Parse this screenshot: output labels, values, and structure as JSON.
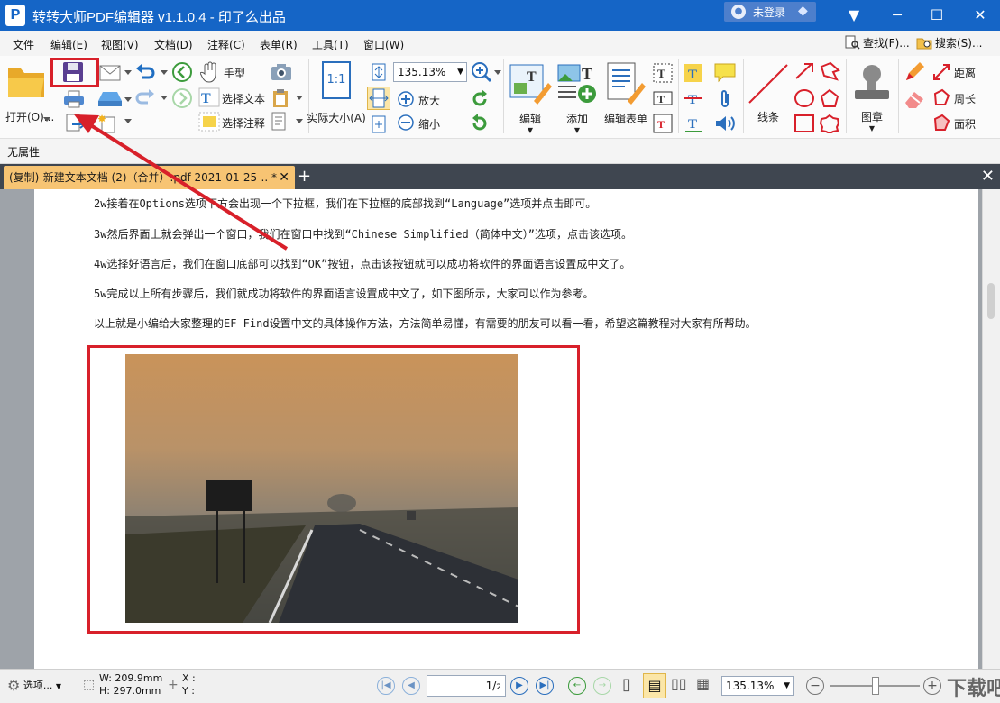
{
  "titlebar": {
    "title": "转转大师PDF编辑器 v1.1.0.4 - 印了么出品",
    "user_status": "未登录",
    "logo_letter": "P",
    "accent": "#1565c6"
  },
  "menubar": {
    "items": [
      "文件",
      "编辑(E)",
      "视图(V)",
      "文档(D)",
      "注释(C)",
      "表单(R)",
      "工具(T)",
      "窗口(W)"
    ],
    "find_label": "查找(F)...",
    "search_label": "搜索(S)..."
  },
  "toolbar": {
    "open_label": "打开(O)...",
    "hand_label": "手型",
    "select_text_label": "选择文本",
    "select_annot_label": "选择注释",
    "actual_size_label": "实际大小(A)",
    "actual_size_icon_text": "1:1",
    "zoom_value": "135.13%",
    "zoom_in_label": "放大",
    "zoom_out_label": "缩小",
    "edit_label": "编辑",
    "add_label": "添加",
    "edit_form_label": "编辑表单",
    "lines_label": "线条",
    "stamp_label": "图章",
    "distance_label": "距离",
    "perimeter_label": "周长",
    "area_label": "面积"
  },
  "propbar": {
    "label": "无属性"
  },
  "tabs": {
    "active_label": "(复制)-新建文本文档 (2)（合并）.pdf-2021-01-25-.. *",
    "active_color": "#f7c473"
  },
  "document": {
    "paragraphs": [
      "2w接着在Options选项下方会出现一个下拉框，我们在下拉框的底部找到“Language”选项并点击即可。",
      "3w然后界面上就会弹出一个窗口，我们在窗口中找到“Chinese Simplified（简体中文）”选项，点击该选项。",
      "4w选择好语言后，我们在窗口底部可以找到“OK”按钮，点击该按钮就可以成功将软件的界面语言设置成中文了。",
      "5w完成以上所有步骤后，我们就成功将软件的界面语言设置成中文了，如下图所示，大家可以作为参考。",
      "以上就是小编给大家整理的EF Find设置中文的具体操作方法，方法简单易懂，有需要的朋友可以看一看，希望这篇教程对大家有所帮助。"
    ],
    "highlight_color": "#d8202a"
  },
  "statusbar": {
    "options_label": "选项...",
    "width_label": "W: 209.9mm",
    "height_label": "H: 297.0mm",
    "x_label": "X :",
    "y_label": "Y :",
    "page_current": "1",
    "page_total": "2",
    "zoom_value": "135.13%"
  },
  "watermark": {
    "site": "下载吧"
  }
}
